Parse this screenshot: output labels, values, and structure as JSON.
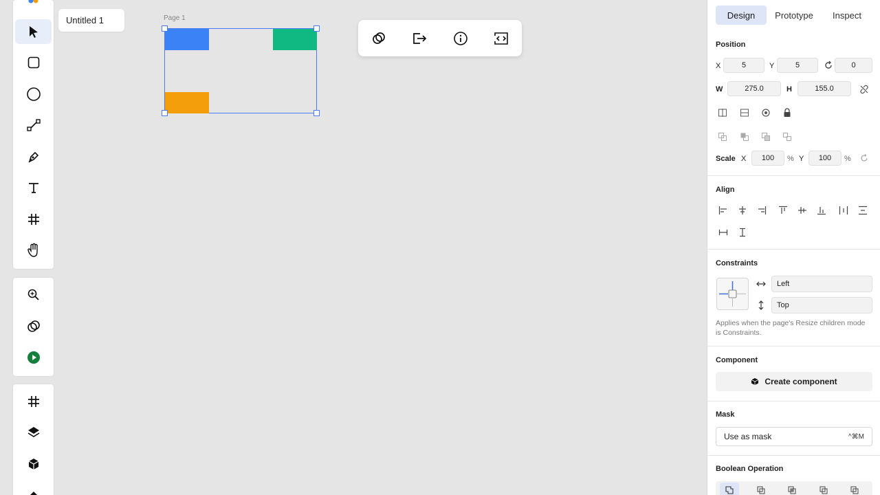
{
  "file_tab": {
    "name": "Untitled 1"
  },
  "canvas": {
    "page_label": "Page 1",
    "shapes": [
      {
        "name": "blue-rectangle",
        "color": "#3b82f6"
      },
      {
        "name": "green-rectangle",
        "color": "#10b981"
      },
      {
        "name": "orange-rectangle",
        "color": "#f59e0b"
      }
    ]
  },
  "left_toolbar": {
    "tools": [
      "pointer-tool",
      "rectangle-tool",
      "ellipse-tool",
      "path-tool",
      "pen-tool",
      "text-tool",
      "frame-tool",
      "hand-tool"
    ],
    "secondary_tools": [
      "zoom-tool",
      "boolean-tool",
      "play-tool"
    ],
    "tertiary_tools": [
      "frames-panel",
      "layers-panel",
      "components-panel"
    ]
  },
  "action_bar": {
    "buttons": [
      "link-icon",
      "export-icon",
      "info-icon",
      "code-icon"
    ]
  },
  "panel": {
    "tabs": [
      "Design",
      "Prototype",
      "Inspect"
    ],
    "active_tab": "Design",
    "position": {
      "title": "Position",
      "x_label": "X",
      "x_value": "5",
      "y_label": "Y",
      "y_value": "5",
      "rotation_value": "0",
      "w_label": "W",
      "w_value": "275.0",
      "h_label": "H",
      "h_value": "155.0"
    },
    "scale": {
      "label": "Scale",
      "x_label": "X",
      "x_value": "100",
      "x_unit": "%",
      "y_label": "Y",
      "y_value": "100",
      "y_unit": "%"
    },
    "align": {
      "title": "Align"
    },
    "constraints": {
      "title": "Constraints",
      "horizontal": "Left",
      "vertical": "Top",
      "note": "Applies when the page's Resize children mode is Constraints."
    },
    "component": {
      "title": "Component",
      "button": "Create component"
    },
    "mask": {
      "title": "Mask",
      "button": "Use as mask",
      "shortcut": "^⌘M"
    },
    "boolean": {
      "title": "Boolean Operation"
    }
  }
}
